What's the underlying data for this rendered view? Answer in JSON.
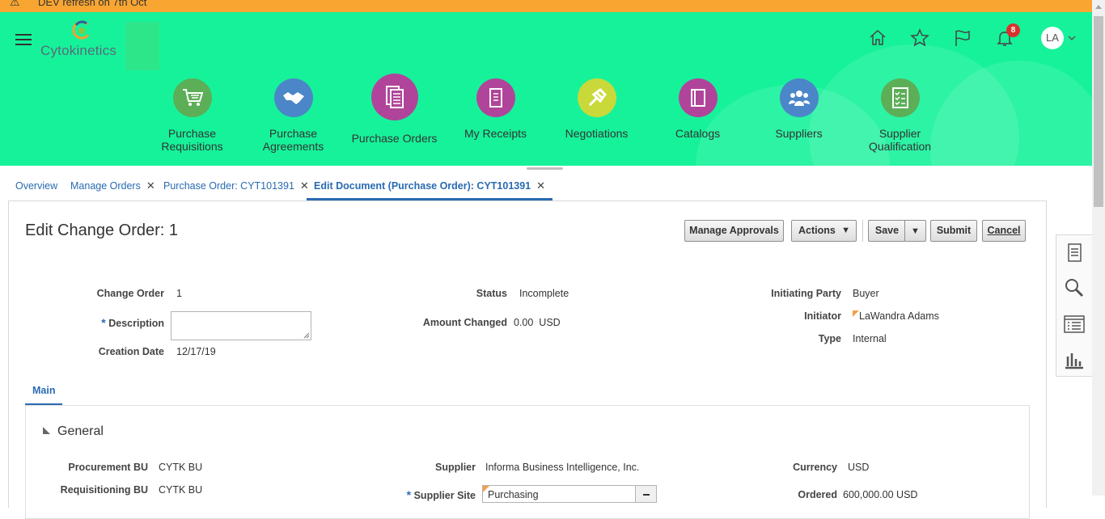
{
  "banner": {
    "text": "DEV refresh on 7th Oct"
  },
  "brand": {
    "logo_text": "Cytokinetics"
  },
  "user": {
    "initials": "LA",
    "notification_count": "8"
  },
  "nav": [
    {
      "label": "Purchase Requisitions",
      "color": "#5cae57",
      "icon": "cart-icon"
    },
    {
      "label": "Purchase Agreements",
      "color": "#4b86c8",
      "icon": "handshake-icon"
    },
    {
      "label": "Purchase Orders",
      "color": "#b0449a",
      "icon": "document-stack-icon"
    },
    {
      "label": "My Receipts",
      "color": "#b0449a",
      "icon": "receipt-icon"
    },
    {
      "label": "Negotiations",
      "color": "#c9d93a",
      "icon": "gavel-icon"
    },
    {
      "label": "Catalogs",
      "color": "#b0449a",
      "icon": "book-icon"
    },
    {
      "label": "Suppliers",
      "color": "#4b86c8",
      "icon": "people-icon"
    },
    {
      "label": "Supplier Qualification",
      "color": "#5cae57",
      "icon": "checklist-icon"
    }
  ],
  "tabs": [
    {
      "label": "Overview"
    },
    {
      "label": "Manage Orders"
    },
    {
      "label": "Purchase Order: CYT101391"
    },
    {
      "label": "Edit Document (Purchase Order): CYT101391"
    }
  ],
  "page": {
    "title": "Edit Change Order: 1",
    "buttons": {
      "manage_approvals": "Manage Approvals",
      "actions": "Actions",
      "save": "Save",
      "submit": "Submit",
      "cancel": "Cancel"
    }
  },
  "header_fields": {
    "change_order_label": "Change Order",
    "change_order_value": "1",
    "description_label": "Description",
    "description_value": "",
    "creation_date_label": "Creation Date",
    "creation_date_value": "12/17/19",
    "status_label": "Status",
    "status_value": "Incomplete",
    "amount_changed_label": "Amount Changed",
    "amount_changed_value": "0.00",
    "amount_changed_currency": "USD",
    "initiating_party_label": "Initiating Party",
    "initiating_party_value": "Buyer",
    "initiator_label": "Initiator",
    "initiator_value": "LaWandra Adams",
    "type_label": "Type",
    "type_value": "Internal"
  },
  "sub_tabs": [
    {
      "label": "Main"
    }
  ],
  "general": {
    "title": "General",
    "procurement_bu_label": "Procurement BU",
    "procurement_bu_value": "CYTK BU",
    "requisitioning_bu_label": "Requisitioning BU",
    "requisitioning_bu_value": "CYTK BU",
    "supplier_label": "Supplier",
    "supplier_value": "Informa Business Intelligence, Inc.",
    "supplier_site_label": "Supplier Site",
    "supplier_site_value": "Purchasing",
    "currency_label": "Currency",
    "currency_value": "USD",
    "ordered_label": "Ordered",
    "ordered_value": "600,000.00",
    "ordered_currency": "USD"
  }
}
